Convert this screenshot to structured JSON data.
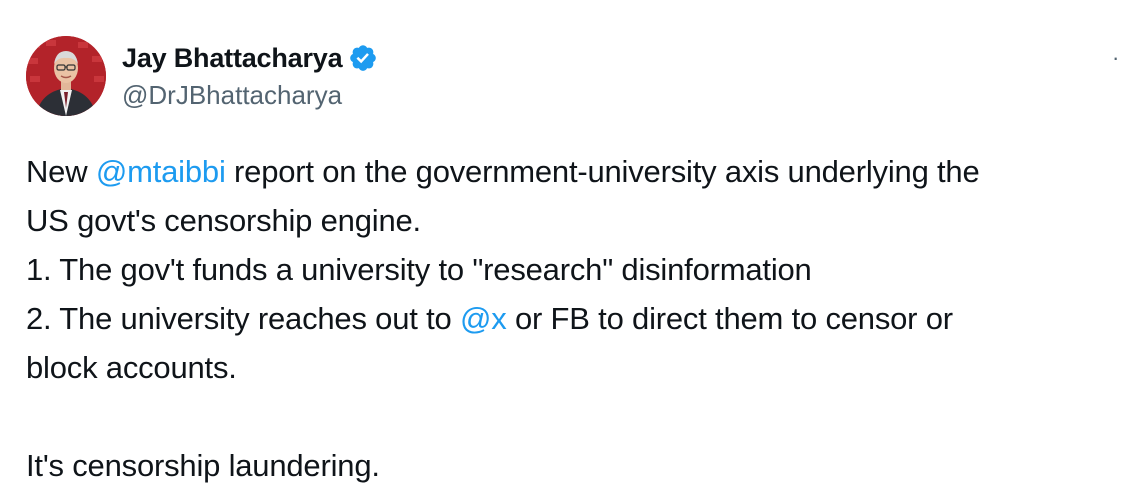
{
  "author": {
    "display_name": "Jay Bhattacharya",
    "handle": "@DrJBhattacharya",
    "verified": true,
    "verified_icon": "verified-badge-icon",
    "avatar_icon": "profile-photo"
  },
  "more_menu": {
    "icon": "more-options-icon",
    "glyph": "·"
  },
  "tweet": {
    "lines": [
      {
        "pre": "New ",
        "mention": "@mtaibbi",
        "post": " report on the government-university axis underlying the"
      },
      {
        "text": "US govt's censorship engine."
      },
      {
        "text": "1.  The gov't funds a university to \"research\" disinformation"
      },
      {
        "pre": "2. The university reaches out to ",
        "mention": "@x",
        "post": " or FB to direct them to censor or"
      },
      {
        "text": "block accounts."
      },
      {
        "text": ""
      },
      {
        "text": "It's censorship laundering."
      }
    ]
  },
  "colors": {
    "link": "#1d9bf0",
    "verified": "#1d9bf0",
    "secondary_text": "#536471",
    "primary_text": "#0f1419"
  }
}
